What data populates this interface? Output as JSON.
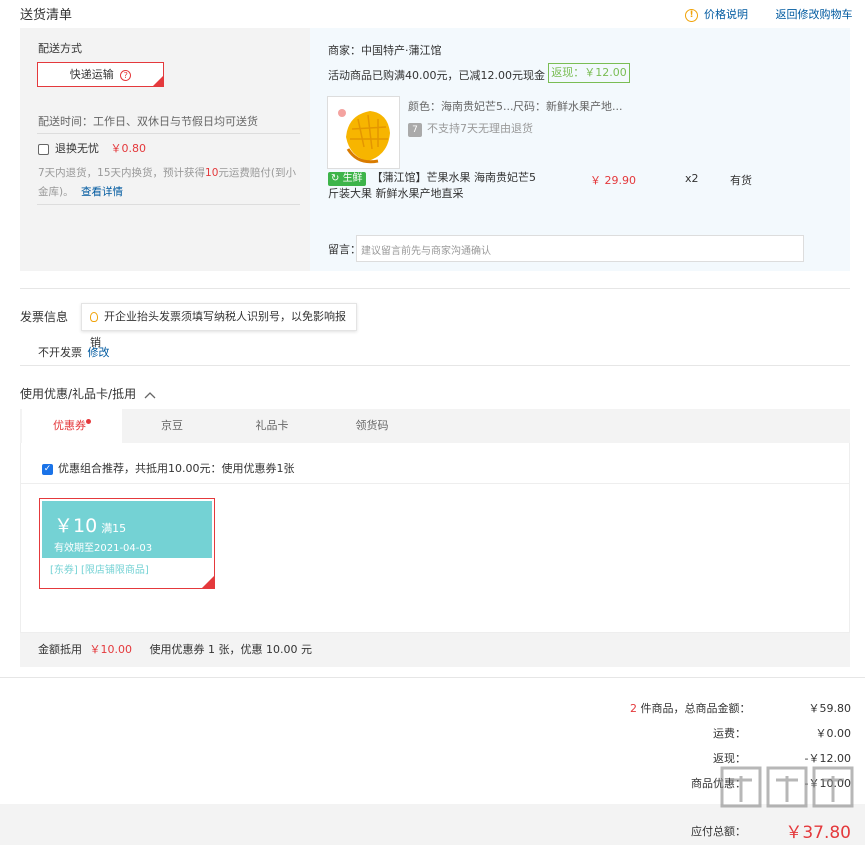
{
  "section_title": "送货清单",
  "top_links": {
    "price_note": "价格说明",
    "back_to_cart": "返回修改购物车"
  },
  "delivery": {
    "heading": "配送方式",
    "method": "快递运输",
    "help_glyph": "?",
    "time_label": "配送时间：工作日、双休日与节假日均可送货",
    "return_worry_label": "退换无忧",
    "return_worry_price": "￥0.80",
    "desc_1": "7天内退货，15天内换货，预计获得",
    "desc_highlight": "10",
    "desc_2": "元运费赔付(到小",
    "desc_3": "金库)。",
    "detail_link": "查看详情"
  },
  "shop": {
    "name_label": "商家：中国特产·蒲江馆",
    "promo_text": "活动商品已购满40.00元，已减12.00元现金",
    "cashback": "返现：￥12.00",
    "color_text": "颜色：海南贵妃芒5...",
    "size_text": "尺码：新鲜水果产地...",
    "no_return_icon": "7",
    "no_return_text": "不支持7天无理由退货",
    "fresh_badge": "生鲜",
    "product_title_1": "【蒲江馆】芒果水果 海南贵妃芒5",
    "product_title_2": "斤装大果 新鲜水果产地直采",
    "price": "￥ 29.90",
    "qty": "x2",
    "stock": "有货",
    "message_label": "留言：",
    "message_placeholder": "建议留言前先与商家沟通确认"
  },
  "invoice": {
    "label": "发票信息",
    "tip": "开企业抬头发票须填写纳税人识别号，以免影响报销",
    "status": "不开发票",
    "edit": "修改"
  },
  "discounts": {
    "heading": "使用优惠/礼品卡/抵用",
    "tabs": [
      "优惠券",
      "京豆",
      "礼品卡",
      "领货码"
    ],
    "combo_text": "优惠组合推荐，共抵用10.00元：使用优惠券1张",
    "coupon": {
      "amount": "￥10",
      "condition": "满15",
      "validity": "有效期至2021-04-03",
      "tags": "[东券]  [限店铺限商品]"
    },
    "summary_label": "金额抵用",
    "summary_amount": "￥10.00",
    "summary_detail": "使用优惠券 1 张，优惠 10.00 元"
  },
  "totals": {
    "count": "2",
    "count_label": "件商品，总商品金额：",
    "goods_total": "￥59.80",
    "shipping_label": "运费：",
    "shipping": "￥0.00",
    "cashback_label": "返现：",
    "cashback": "-￥12.00",
    "coupon_label": "商品优惠：",
    "coupon": "-￥10.00",
    "payable_label": "应付总额：",
    "payable": "￥37.80"
  },
  "colors": {
    "accent_red": "#e4393c",
    "link_blue": "#005aa0",
    "coupon_teal": "#74d2d4",
    "green": "#7abd54"
  }
}
